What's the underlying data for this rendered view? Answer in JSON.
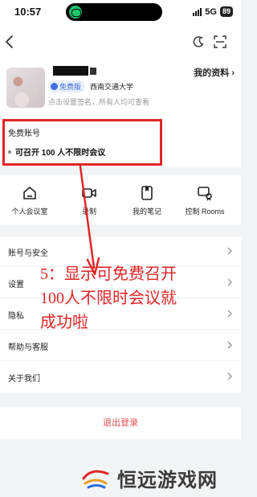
{
  "status_bar": {
    "time": "10:57",
    "network": "5G",
    "battery": "89"
  },
  "profile": {
    "my_profile_link": "我的资料 ›",
    "badge": "免费版",
    "organization": "西南交通大学",
    "signature_hint": "点击设置签名，所有人均可查看"
  },
  "account": {
    "title": "免费账号",
    "feature": "可召开 100 人不限时会议"
  },
  "quick_actions": [
    {
      "label": "个人会议室",
      "icon": "meeting-room-icon"
    },
    {
      "label": "录制",
      "icon": "video-record-icon"
    },
    {
      "label": "我的笔记",
      "icon": "notes-icon"
    },
    {
      "label": "控制 Rooms",
      "icon": "control-rooms-icon"
    }
  ],
  "settings": [
    {
      "label": "账号与安全"
    },
    {
      "label": "设置"
    },
    {
      "label": "隐私"
    },
    {
      "label": "帮助与客服"
    },
    {
      "label": "关于我们"
    }
  ],
  "logout_label": "退出登录",
  "annotation": "5：显示可免费召开\n100人不限时会议就\n成功啦",
  "watermark": "恒远游戏网",
  "colors": {
    "highlight_red": "#e02626",
    "logout_red": "#e34d4d",
    "badge_blue": "#3d6fe0",
    "status_green": "#1fc36b"
  }
}
